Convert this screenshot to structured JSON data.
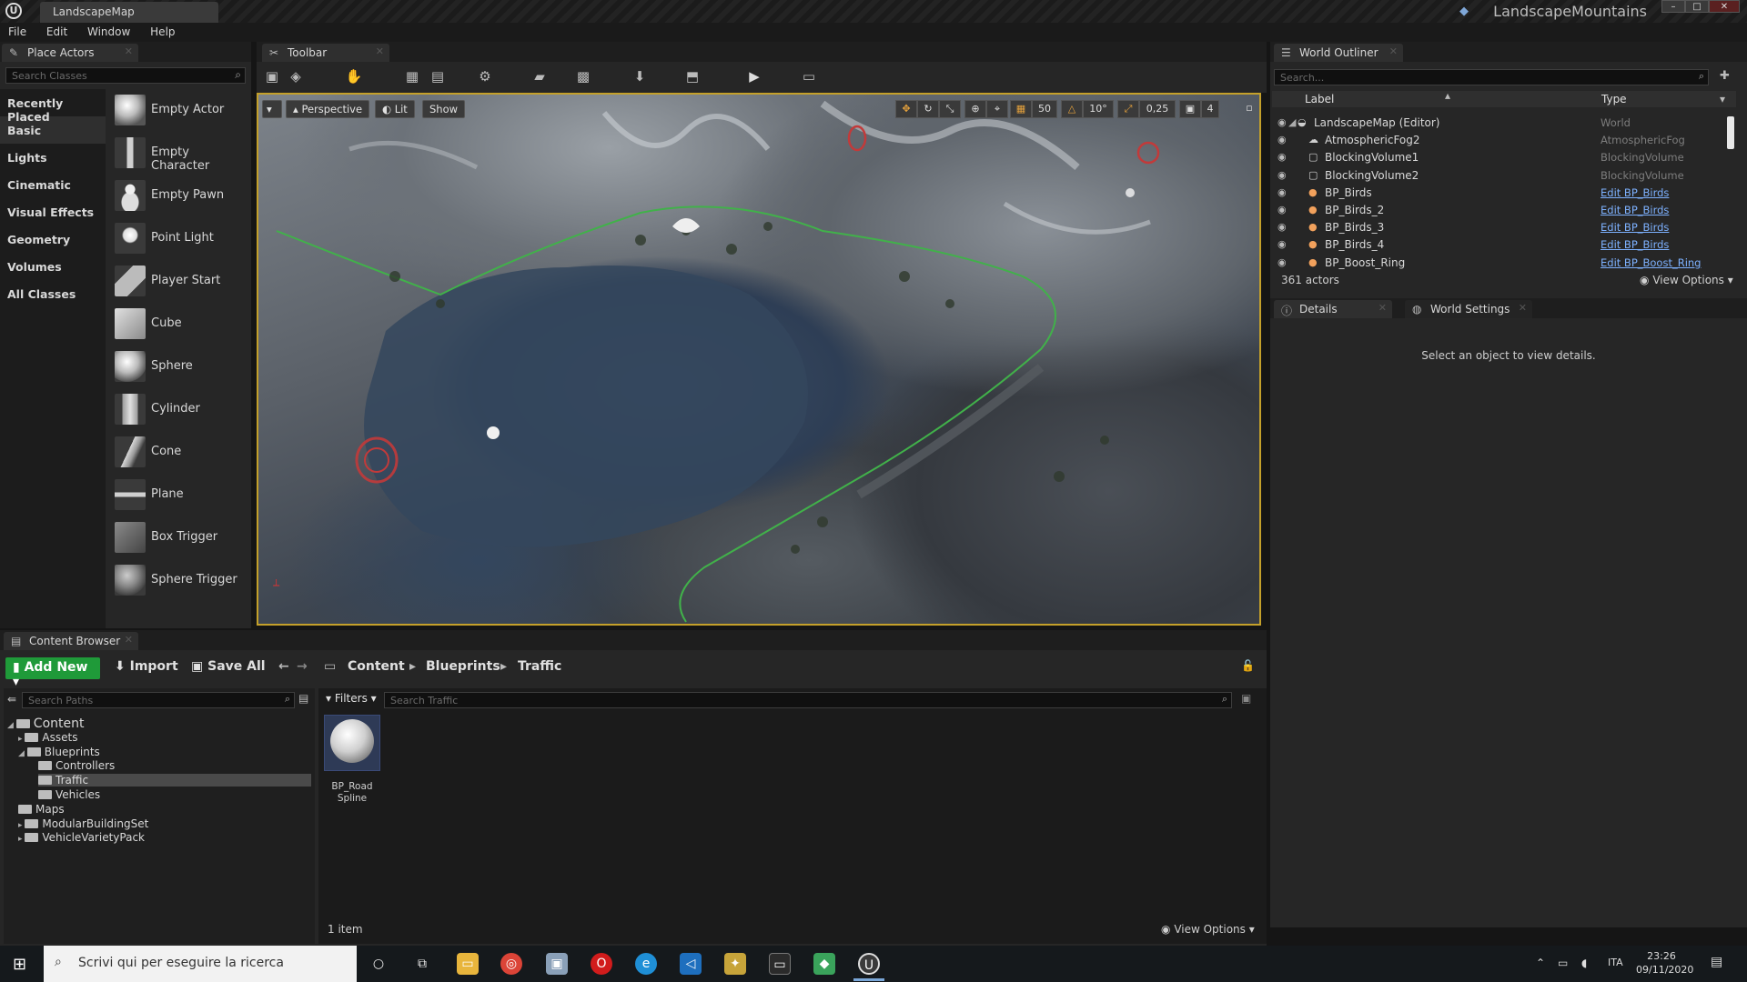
{
  "titlebar": {
    "map_tab": "LandscapeMap",
    "project_name": "LandscapeMountains"
  },
  "menu": [
    "File",
    "Edit",
    "Window",
    "Help"
  ],
  "place_actors": {
    "tab_label": "Place Actors",
    "search_placeholder": "Search Classes",
    "categories": [
      "Recently Placed",
      "Basic",
      "Lights",
      "Cinematic",
      "Visual Effects",
      "Geometry",
      "Volumes",
      "All Classes"
    ],
    "selected_category": "Basic",
    "actors": [
      "Empty Actor",
      "Empty Character",
      "Empty Pawn",
      "Point Light",
      "Player Start",
      "Cube",
      "Sphere",
      "Cylinder",
      "Cone",
      "Plane",
      "Box Trigger",
      "Sphere Trigger"
    ]
  },
  "viewport": {
    "tab_label": "Toolbar",
    "perspective_label": "Perspective",
    "lit_label": "Lit",
    "show_label": "Show",
    "grid_snap": "50",
    "rot_snap": "10°",
    "scale_snap": "0,25",
    "camera_speed": "4"
  },
  "world_outliner": {
    "tab_label": "World Outliner",
    "search_placeholder": "Search...",
    "col_label": "Label",
    "col_type": "Type",
    "rows": [
      {
        "name": "LandscapeMap (Editor)",
        "type": "World",
        "link": false,
        "icon": "world-icon"
      },
      {
        "name": "AtmosphericFog2",
        "type": "AtmosphericFog",
        "link": false,
        "icon": "fog-icon"
      },
      {
        "name": "BlockingVolume1",
        "type": "BlockingVolume",
        "link": false,
        "icon": "volume-icon"
      },
      {
        "name": "BlockingVolume2",
        "type": "BlockingVolume",
        "link": false,
        "icon": "volume-icon"
      },
      {
        "name": "BP_Birds",
        "type": "Edit BP_Birds",
        "link": true,
        "icon": "blueprint-icon"
      },
      {
        "name": "BP_Birds_2",
        "type": "Edit BP_Birds",
        "link": true,
        "icon": "blueprint-icon"
      },
      {
        "name": "BP_Birds_3",
        "type": "Edit BP_Birds",
        "link": true,
        "icon": "blueprint-icon"
      },
      {
        "name": "BP_Birds_4",
        "type": "Edit BP_Birds",
        "link": true,
        "icon": "blueprint-icon"
      },
      {
        "name": "BP_Boost_Ring",
        "type": "Edit BP_Boost_Ring",
        "link": true,
        "icon": "blueprint-icon"
      }
    ],
    "actor_count": "361 actors",
    "view_options": "View Options"
  },
  "details": {
    "tab_details": "Details",
    "tab_world_settings": "World Settings",
    "empty_text": "Select an object to view details."
  },
  "content_browser": {
    "tab_label": "Content Browser",
    "add_new": "Add New",
    "import": "Import",
    "save_all": "Save All",
    "breadcrumb": [
      "Content",
      "Blueprints",
      "Traffic"
    ],
    "path_search_placeholder": "Search Paths",
    "filters": "Filters",
    "asset_search_placeholder": "Search Traffic",
    "tree": [
      {
        "label": "Content",
        "depth": 0
      },
      {
        "label": "Assets",
        "depth": 1
      },
      {
        "label": "Blueprints",
        "depth": 1
      },
      {
        "label": "Controllers",
        "depth": 2
      },
      {
        "label": "Traffic",
        "depth": 2,
        "selected": true
      },
      {
        "label": "Vehicles",
        "depth": 2
      },
      {
        "label": "Maps",
        "depth": 1
      },
      {
        "label": "ModularBuildingSet",
        "depth": 1
      },
      {
        "label": "VehicleVarietyPack",
        "depth": 1
      }
    ],
    "asset_name_line1": "BP_Road",
    "asset_name_line2": "Spline",
    "item_count": "1 item",
    "view_options": "View Options"
  },
  "taskbar": {
    "search_placeholder": "Scrivi qui per eseguire la ricerca",
    "language": "ITA",
    "time": "23:26",
    "date": "09/11/2020"
  }
}
